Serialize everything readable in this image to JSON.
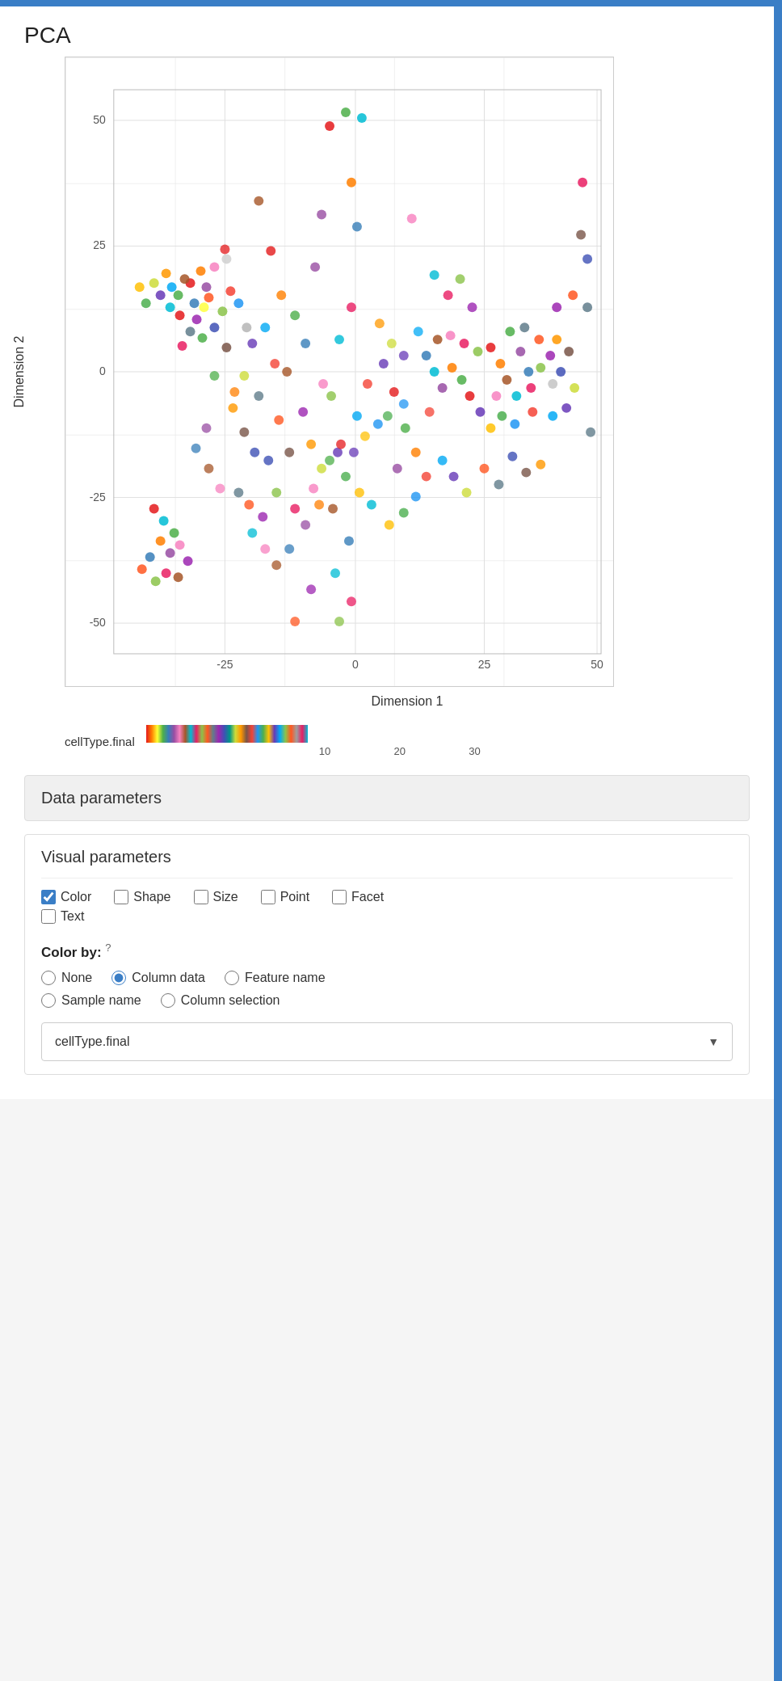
{
  "topbar": {
    "color": "#3a7ec6"
  },
  "chart": {
    "title": "PCA",
    "xLabel": "Dimension 1",
    "yLabel": "Dimension 2",
    "xTicks": [
      "-25",
      "0",
      "25",
      "50"
    ],
    "yTicks": [
      "-50",
      "-25",
      "0",
      "25",
      "50"
    ],
    "legend": {
      "name": "cellType.final",
      "ticks": [
        "10",
        "20",
        "30"
      ]
    }
  },
  "sections": {
    "dataParams": {
      "title": "Data parameters"
    },
    "visualParams": {
      "title": "Visual parameters"
    }
  },
  "checkboxes": [
    {
      "label": "Color",
      "checked": true
    },
    {
      "label": "Shape",
      "checked": false
    },
    {
      "label": "Size",
      "checked": false
    },
    {
      "label": "Point",
      "checked": false
    },
    {
      "label": "Facet",
      "checked": false
    },
    {
      "label": "Text",
      "checked": false
    }
  ],
  "colorBy": {
    "label": "Color by:",
    "tooltip": "?",
    "options": [
      {
        "label": "None",
        "value": "none",
        "selected": false
      },
      {
        "label": "Column data",
        "value": "column_data",
        "selected": true
      },
      {
        "label": "Feature name",
        "value": "feature_name",
        "selected": false
      },
      {
        "label": "Sample name",
        "value": "sample_name",
        "selected": false
      },
      {
        "label": "Column selection",
        "value": "column_selection",
        "selected": false
      }
    ],
    "dropdownValue": "cellType.final"
  }
}
